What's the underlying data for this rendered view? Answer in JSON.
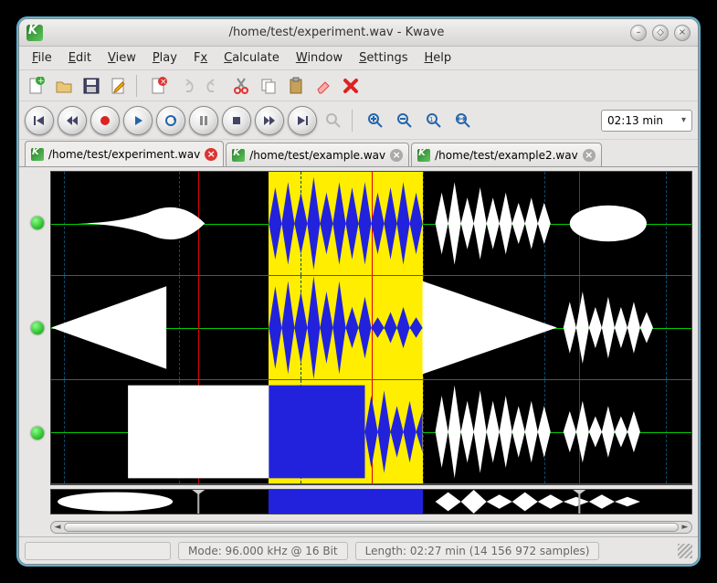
{
  "window": {
    "title": "/home/test/experiment.wav - Kwave"
  },
  "menu": {
    "file": "File",
    "edit": "Edit",
    "view": "View",
    "play": "Play",
    "fx": "Fx",
    "calculate": "Calculate",
    "window": "Window",
    "settings": "Settings",
    "help": "Help"
  },
  "zoom_combo": "02:13 min",
  "tabs": [
    {
      "label": "/home/test/experiment.wav",
      "active": true,
      "close": "red"
    },
    {
      "label": "/home/test/example.wav",
      "active": false,
      "close": "gray"
    },
    {
      "label": "/home/test/example2.wav",
      "active": false,
      "close": "gray"
    }
  ],
  "status": {
    "mode": "Mode: 96.000 kHz @ 16 Bit",
    "length": "Length: 02:27 min (14 156 972 samples)"
  },
  "selection": {
    "start_pct": 34,
    "end_pct": 58
  },
  "markers_pct": [
    23,
    50,
    82.5
  ],
  "grid_pct": [
    2,
    20,
    39,
    58,
    77,
    96
  ]
}
